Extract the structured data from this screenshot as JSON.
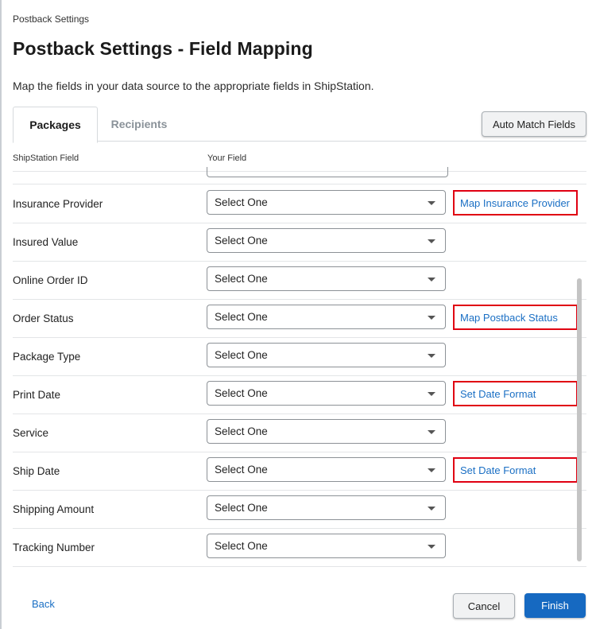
{
  "breadcrumb": "Postback Settings",
  "title": "Postback Settings - Field Mapping",
  "description": "Map the fields in your data source to the appropriate fields in ShipStation.",
  "tabs": [
    {
      "label": "Packages",
      "active": true
    },
    {
      "label": "Recipients",
      "active": false
    }
  ],
  "auto_match_label": "Auto Match Fields",
  "columns": {
    "shipstation": "ShipStation Field",
    "yours": "Your Field"
  },
  "rows": [
    {
      "label": "Insurance Provider",
      "value": "Select One",
      "action": "Map Insurance Provider"
    },
    {
      "label": "Insured Value",
      "value": "Select One"
    },
    {
      "label": "Online Order ID",
      "value": "Select One"
    },
    {
      "label": "Order Status",
      "value": "Select One",
      "action": "Map Postback Status"
    },
    {
      "label": "Package Type",
      "value": "Select One"
    },
    {
      "label": "Print Date",
      "value": "Select One",
      "action": "Set Date Format"
    },
    {
      "label": "Service",
      "value": "Select One"
    },
    {
      "label": "Ship Date",
      "value": "Select One",
      "action": "Set Date Format"
    },
    {
      "label": "Shipping Amount",
      "value": "Select One"
    },
    {
      "label": "Tracking Number",
      "value": "Select One"
    }
  ],
  "footer": {
    "back": "Back",
    "cancel": "Cancel",
    "finish": "Finish"
  },
  "colors": {
    "link": "#1a6fc4",
    "primary": "#1669c1",
    "highlight": "#e00012"
  },
  "icons": {
    "dropdown": "caret-down-icon"
  }
}
